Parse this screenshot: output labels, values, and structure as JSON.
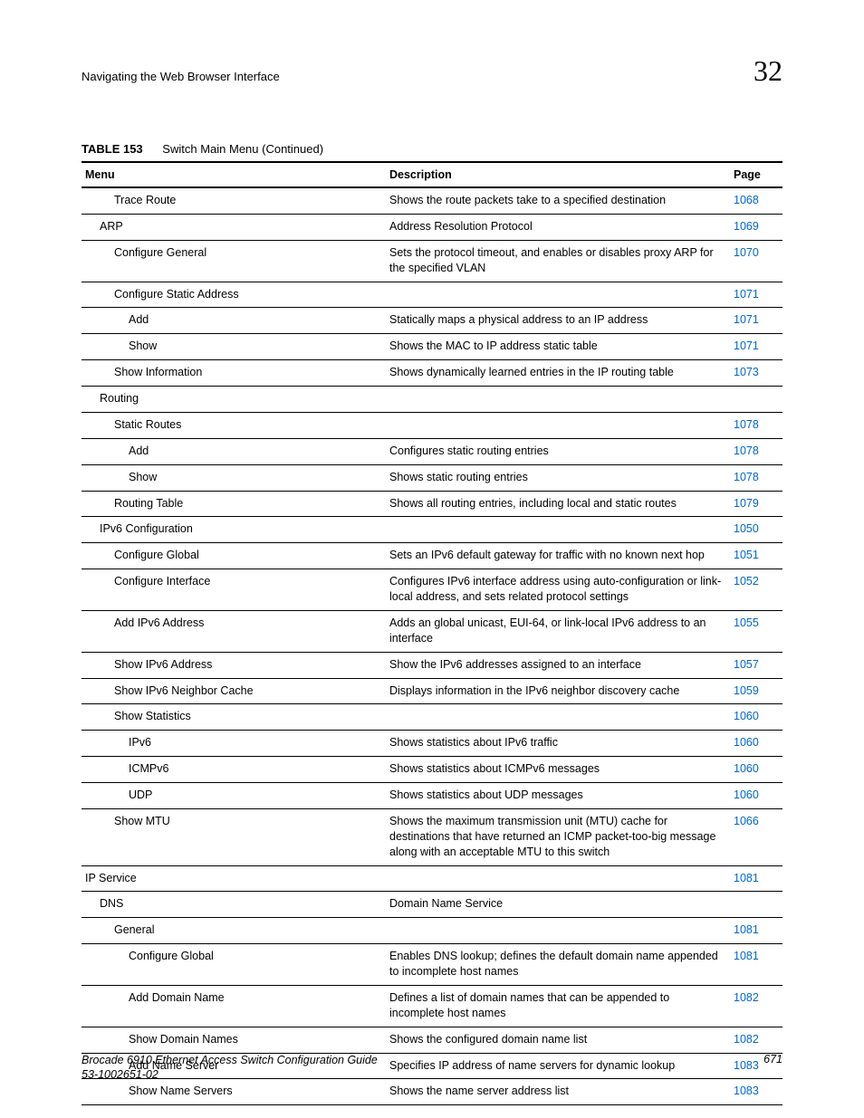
{
  "header": {
    "title": "Navigating the Web Browser Interface",
    "chapter": "32"
  },
  "table": {
    "label": "TABLE 153",
    "title": "Switch Main Menu (Continued)",
    "columns": {
      "menu": "Menu",
      "description": "Description",
      "page": "Page"
    },
    "rows": [
      {
        "indent": 2,
        "menu": "Trace Route",
        "description": "Shows the route packets take to a specified destination",
        "page": "1068"
      },
      {
        "indent": 1,
        "menu": "ARP",
        "description": "Address Resolution Protocol",
        "page": "1069"
      },
      {
        "indent": 2,
        "menu": "Configure General",
        "description": "Sets the protocol timeout, and enables or disables proxy ARP for the specified VLAN",
        "page": "1070"
      },
      {
        "indent": 2,
        "menu": "Configure Static Address",
        "description": "",
        "page": "1071"
      },
      {
        "indent": 3,
        "menu": "Add",
        "description": "Statically maps a physical address to an IP address",
        "page": "1071"
      },
      {
        "indent": 3,
        "menu": "Show",
        "description": "Shows the MAC to IP address static table",
        "page": "1071"
      },
      {
        "indent": 2,
        "menu": "Show Information",
        "description": "Shows dynamically learned entries in the IP routing table",
        "page": "1073"
      },
      {
        "indent": 1,
        "menu": "Routing",
        "description": "",
        "page": ""
      },
      {
        "indent": 2,
        "menu": "Static Routes",
        "description": "",
        "page": "1078"
      },
      {
        "indent": 3,
        "menu": "Add",
        "description": "Configures static routing entries",
        "page": "1078"
      },
      {
        "indent": 3,
        "menu": "Show",
        "description": "Shows static routing entries",
        "page": "1078"
      },
      {
        "indent": 2,
        "menu": "Routing Table",
        "description": "Shows all routing entries, including local and static routes",
        "page": "1079"
      },
      {
        "indent": 1,
        "menu": "IPv6 Configuration",
        "description": "",
        "page": "1050"
      },
      {
        "indent": 2,
        "menu": "Configure Global",
        "description": "Sets an IPv6 default gateway for traffic with no known next hop",
        "page": "1051"
      },
      {
        "indent": 2,
        "menu": "Configure Interface",
        "description": "Configures IPv6 interface address using auto-configuration or link-local address, and sets related protocol settings",
        "page": "1052"
      },
      {
        "indent": 2,
        "menu": "Add IPv6 Address",
        "description": "Adds an global unicast, EUI-64, or link-local IPv6 address to an interface",
        "page": "1055"
      },
      {
        "indent": 2,
        "menu": "Show IPv6 Address",
        "description": "Show the IPv6 addresses assigned to an interface",
        "page": "1057"
      },
      {
        "indent": 2,
        "menu": "Show IPv6 Neighbor Cache",
        "description": "Displays information in the IPv6 neighbor discovery cache",
        "page": "1059"
      },
      {
        "indent": 2,
        "menu": "Show Statistics",
        "description": "",
        "page": "1060"
      },
      {
        "indent": 3,
        "menu": "IPv6",
        "description": "Shows statistics about IPv6 traffic",
        "page": "1060"
      },
      {
        "indent": 3,
        "menu": "ICMPv6",
        "description": "Shows statistics about ICMPv6 messages",
        "page": "1060"
      },
      {
        "indent": 3,
        "menu": "UDP",
        "description": "Shows statistics about UDP messages",
        "page": "1060"
      },
      {
        "indent": 2,
        "menu": "Show MTU",
        "description": "Shows the maximum transmission unit (MTU) cache for destinations that have returned an ICMP packet-too-big message along with an acceptable MTU to this switch",
        "page": "1066"
      },
      {
        "indent": 0,
        "menu": "IP Service",
        "description": "",
        "page": "1081"
      },
      {
        "indent": 1,
        "menu": "DNS",
        "description": "Domain Name Service",
        "page": ""
      },
      {
        "indent": 2,
        "menu": "General",
        "description": "",
        "page": "1081"
      },
      {
        "indent": 3,
        "menu": "Configure Global",
        "description": "Enables DNS lookup; defines the default domain name appended to incomplete host names",
        "page": "1081"
      },
      {
        "indent": 3,
        "menu": "Add Domain Name",
        "description": "Defines a list of domain names that can be appended to incomplete host names",
        "page": "1082"
      },
      {
        "indent": 3,
        "menu": "Show Domain Names",
        "description": "Shows the configured domain name list",
        "page": "1082"
      },
      {
        "indent": 3,
        "menu": "Add Name Server",
        "description": "Specifies IP address of name servers for dynamic lookup",
        "page": "1083"
      },
      {
        "indent": 3,
        "menu": "Show Name Servers",
        "description": "Shows the name server address list",
        "page": "1083"
      }
    ]
  },
  "footer": {
    "guide": "Brocade 6910 Ethernet Access Switch Configuration Guide",
    "docnum": "53-1002651-02",
    "pagenum": "671"
  }
}
